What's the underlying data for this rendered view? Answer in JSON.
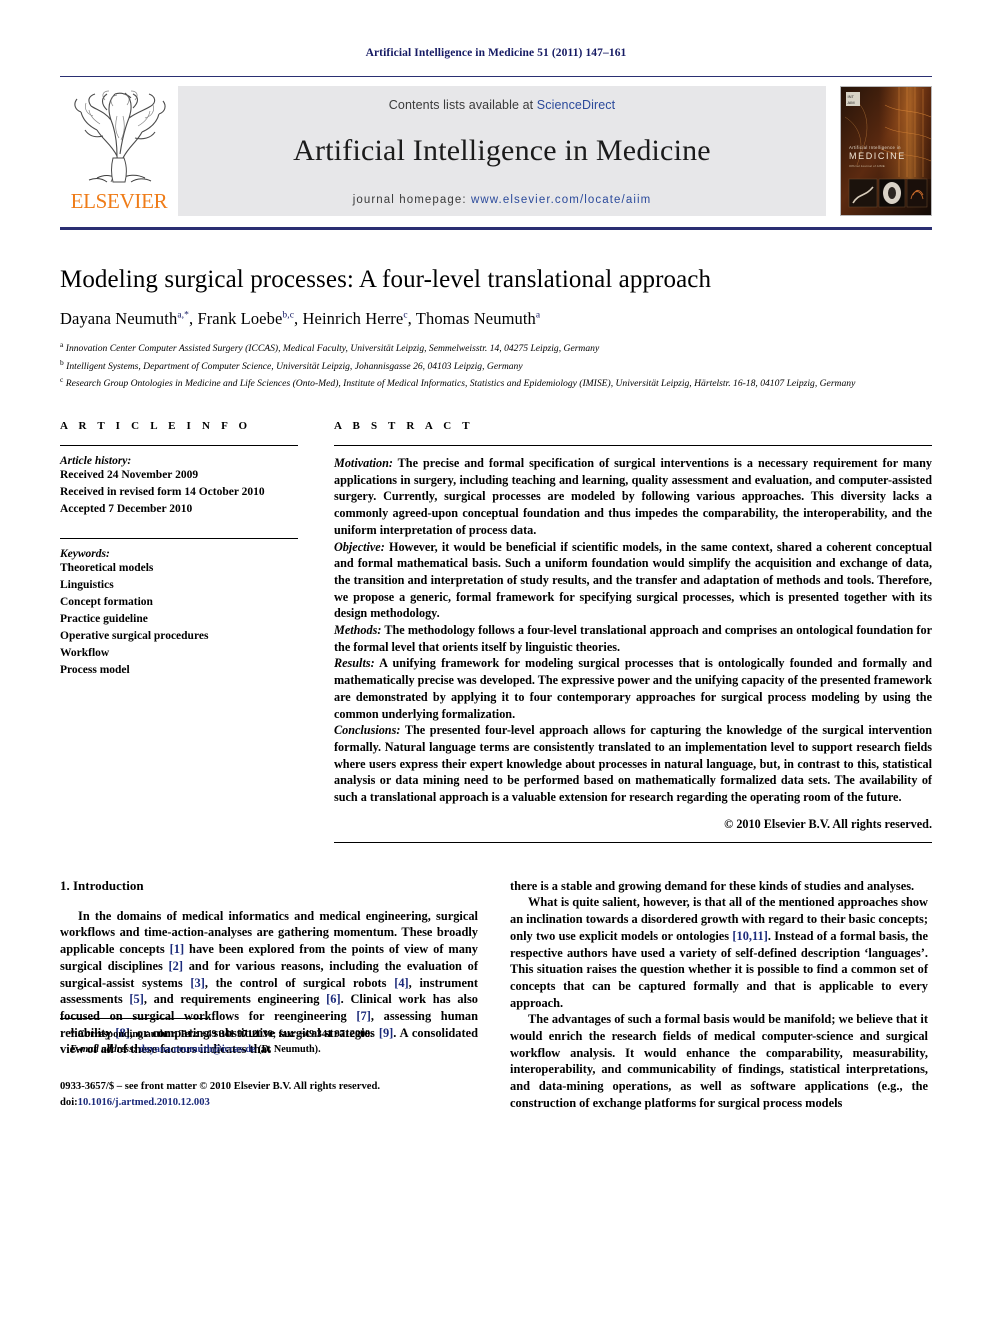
{
  "running_head": "Artificial Intelligence in Medicine 51 (2011) 147–161",
  "masthead": {
    "contents_prefix": "Contents lists available at ",
    "contents_link": "ScienceDirect",
    "journal_title": "Artificial Intelligence in Medicine",
    "homepage_prefix": "journal homepage: ",
    "homepage_url": "www.elsevier.com/locate/aiim",
    "publisher_wordmark": "ELSEVIER",
    "cover_title_small": "Artificial Intelligence in",
    "cover_title_big": "MEDICINE"
  },
  "article": {
    "title": "Modeling surgical processes: A four-level translational approach",
    "authors": [
      {
        "name": "Dayana Neumuth",
        "marks": "a,*"
      },
      {
        "name": "Frank Loebe",
        "marks": "b,c"
      },
      {
        "name": "Heinrich Herre",
        "marks": "c"
      },
      {
        "name": "Thomas Neumuth",
        "marks": "a"
      }
    ],
    "affiliations": [
      {
        "mark": "a",
        "text": "Innovation Center Computer Assisted Surgery (ICCAS), Medical Faculty, Universität Leipzig, Semmelweisstr. 14, 04275 Leipzig, Germany"
      },
      {
        "mark": "b",
        "text": "Intelligent Systems, Department of Computer Science, Universität Leipzig, Johannisgasse 26, 04103 Leipzig, Germany"
      },
      {
        "mark": "c",
        "text": "Research Group Ontologies in Medicine and Life Sciences (Onto-Med), Institute of Medical Informatics, Statistics and Epidemiology (IMISE), Universität Leipzig, Härtelstr. 16-18, 04107 Leipzig, Germany"
      }
    ]
  },
  "article_info": {
    "heading": "A R T I C L E   I N F O",
    "history_label": "Article history:",
    "history": [
      "Received 24 November 2009",
      "Received in revised form 14 October 2010",
      "Accepted 7 December 2010"
    ],
    "keywords_label": "Keywords:",
    "keywords": [
      "Theoretical models",
      "Linguistics",
      "Concept formation",
      "Practice guideline",
      "Operative surgical procedures",
      "Workflow",
      "Process model"
    ]
  },
  "abstract": {
    "heading": "A B S T R A C T",
    "sections": [
      {
        "label": "Motivation:",
        "text": " The precise and formal specification of surgical interventions is a necessary requirement for many applications in surgery, including teaching and learning, quality assessment and evaluation, and computer-assisted surgery. Currently, surgical processes are modeled by following various approaches. This diversity lacks a commonly agreed-upon conceptual foundation and thus impedes the comparability, the interoperability, and the uniform interpretation of process data."
      },
      {
        "label": "Objective:",
        "text": " However, it would be beneficial if scientific models, in the same context, shared a coherent conceptual and formal mathematical basis. Such a uniform foundation would simplify the acquisition and exchange of data, the transition and interpretation of study results, and the transfer and adaptation of methods and tools. Therefore, we propose a generic, formal framework for specifying surgical processes, which is presented together with its design methodology."
      },
      {
        "label": "Methods:",
        "text": " The methodology follows a four-level translational approach and comprises an ontological foundation for the formal level that orients itself by linguistic theories."
      },
      {
        "label": "Results:",
        "text": " A unifying framework for modeling surgical processes that is ontologically founded and formally and mathematically precise was developed. The expressive power and the unifying capacity of the presented framework are demonstrated by applying it to four contemporary approaches for surgical process modeling by using the common underlying formalization."
      },
      {
        "label": "Conclusions:",
        "text": " The presented four-level approach allows for capturing the knowledge of the surgical intervention formally. Natural language terms are consistently translated to an implementation level to support research fields where users express their expert knowledge about processes in natural language, but, in contrast to this, statistical analysis or data mining need to be performed based on mathematically formalized data sets. The availability of such a translational approach is a valuable extension for research regarding the operating room of the future."
      }
    ],
    "copyright": "© 2010 Elsevier B.V. All rights reserved."
  },
  "body": {
    "section_number_title": "1.  Introduction",
    "left_column": [
      "In the domains of medical informatics and medical engineering, surgical workflows and time-action-analyses are gathering momentum. These broadly applicable concepts [1] have been explored from the points of view of many surgical disciplines [2] and for various reasons, including the evaluation of surgical-assist systems [3], the control of surgical robots [4], instrument assessments [5], and requirements engineering [6]. Clinical work has also focused on surgical workflows for reengineering [7], assessing human reliability [8], or comparing substitutive surgical strategies [9]. A consolidated view of all of these factors indicates that"
    ],
    "right_column": [
      "there is a stable and growing demand for these kinds of studies and analyses.",
      "What is quite salient, however, is that all of the mentioned approaches show an inclination towards a disordered growth with regard to their basic concepts; only two use explicit models or ontologies [10,11]. Instead of a formal basis, the respective authors have used a variety of self-defined description ‘languages’. This situation raises the question whether it is possible to find a common set of concepts that can be captured formally and that is applicable to every approach.",
      "The advantages of such a formal basis would be manifold; we believe that it would enrich the research fields of medical computer-science and surgical workflow analysis. It would enhance the comparability, measurability, interoperability, and communicability of findings, statistical interpretations, and data-mining operations, as well as software applications (e.g., the construction of exchange platforms for surgical process models"
    ]
  },
  "footnotes": {
    "corresponding": "* Corresponding author. Tel.: +49 341 9712030; fax: +49 341 9712009.",
    "email_label": "E-mail address:",
    "email": "dayana.neumuth@iccas.de",
    "email_suffix": " (D. Neumuth).",
    "issn_line": "0933-3657/$ – see front matter © 2010 Elsevier B.V. All rights reserved.",
    "doi_label": "doi:",
    "doi": "10.1016/j.artmed.2010.12.003"
  },
  "colors": {
    "header_blue": "#151a63",
    "link_blue": "#2b4a9b",
    "ref_blue": "#1b2a7a",
    "elsevier_orange": "#ef7c18",
    "band_gray": "#e7e7e9"
  }
}
